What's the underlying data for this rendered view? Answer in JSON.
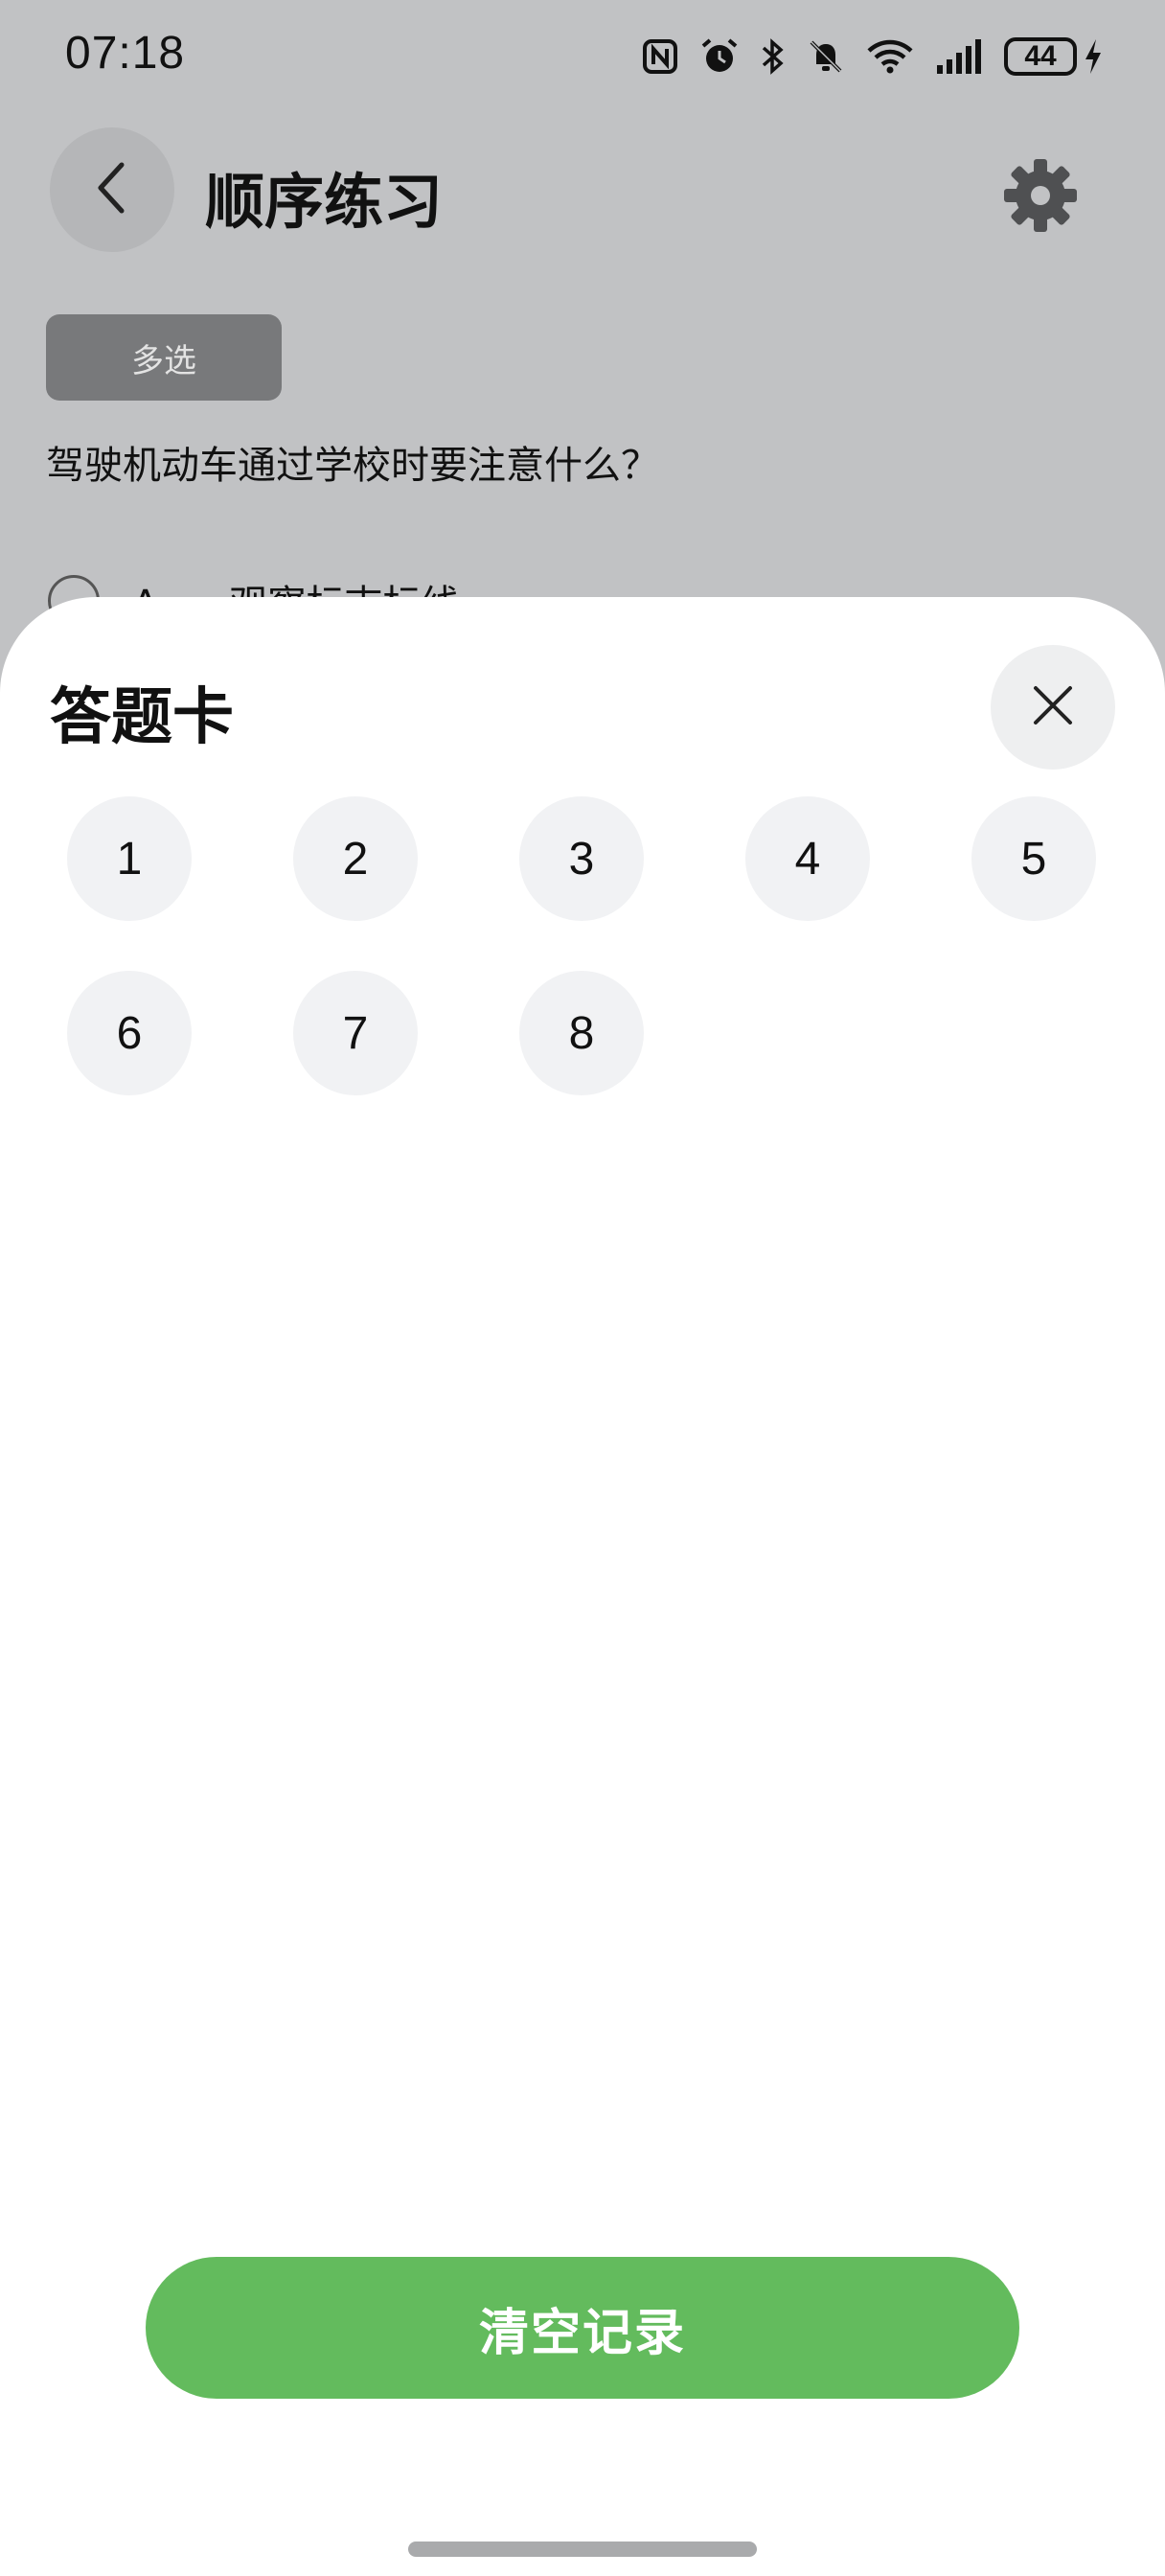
{
  "status_bar": {
    "time": "07:18",
    "battery": "44",
    "icons": [
      "nfc-icon",
      "alarm-icon",
      "bluetooth-icon",
      "mute-icon",
      "wifi-icon",
      "signal-icon",
      "battery-icon",
      "charging-icon"
    ]
  },
  "header": {
    "title": "顺序练习",
    "back_icon": "chevron-left-icon",
    "settings_icon": "gear-icon"
  },
  "question": {
    "type_label": "多选",
    "text": "驾驶机动车通过学校时要注意什么？",
    "option_a_letter": "A、",
    "option_a_text": "观察标志标线"
  },
  "answer_sheet": {
    "title": "答题卡",
    "close_icon": "close-icon",
    "numbers": [
      "1",
      "2",
      "3",
      "4",
      "5",
      "6",
      "7",
      "8"
    ],
    "clear_label": "清空记录"
  },
  "colors": {
    "accent_green": "#63bb5d",
    "dim_overlay": "#c1c2c4",
    "number_bubble": "#f1f2f4"
  }
}
